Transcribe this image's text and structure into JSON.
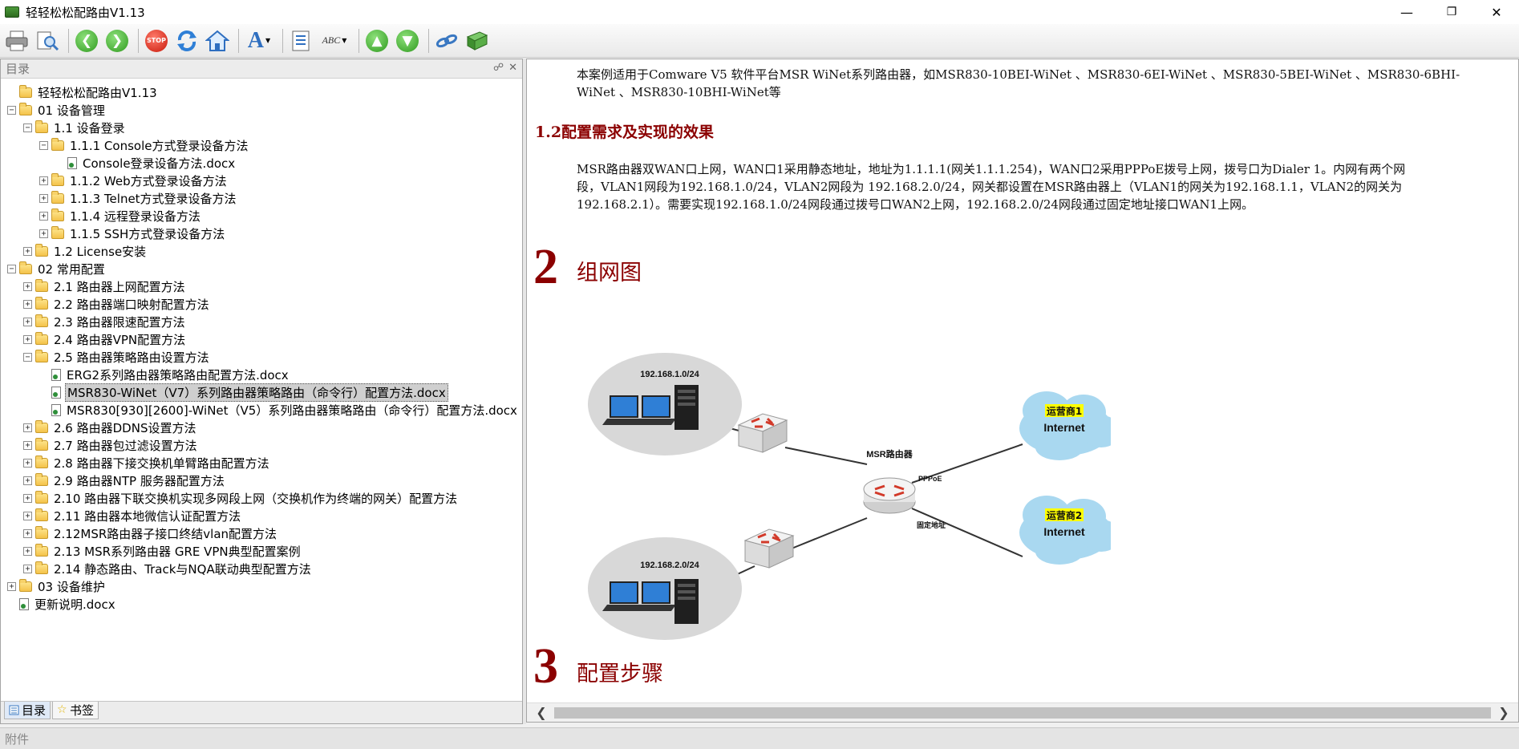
{
  "window": {
    "title": "轻轻松松配路由V1.13",
    "minimize": "—",
    "maximize": "❐",
    "close": "✕"
  },
  "toolbar": {
    "stop_label": "STOP",
    "font_label": "A",
    "spell_label": "ABC"
  },
  "left_panel": {
    "title": "目录",
    "tabs": [
      {
        "label": "目录",
        "active": true
      },
      {
        "label": "书签",
        "active": false
      }
    ]
  },
  "tree": [
    {
      "level": 0,
      "type": "folder",
      "expander": "none",
      "label": "轻轻松松配路由V1.13"
    },
    {
      "level": 0,
      "type": "folder",
      "expander": "minus",
      "label": "01 设备管理"
    },
    {
      "level": 1,
      "type": "folder",
      "expander": "minus",
      "label": "1.1 设备登录"
    },
    {
      "level": 2,
      "type": "folder",
      "expander": "minus",
      "label": "1.1.1 Console方式登录设备方法"
    },
    {
      "level": 3,
      "type": "doc",
      "expander": "none",
      "label": "Console登录设备方法.docx"
    },
    {
      "level": 2,
      "type": "folder",
      "expander": "plus",
      "label": "1.1.2 Web方式登录设备方法"
    },
    {
      "level": 2,
      "type": "folder",
      "expander": "plus",
      "label": "1.1.3 Telnet方式登录设备方法"
    },
    {
      "level": 2,
      "type": "folder",
      "expander": "plus",
      "label": "1.1.4 远程登录设备方法"
    },
    {
      "level": 2,
      "type": "folder",
      "expander": "plus",
      "label": "1.1.5 SSH方式登录设备方法"
    },
    {
      "level": 1,
      "type": "folder",
      "expander": "plus",
      "label": "1.2 License安装"
    },
    {
      "level": 0,
      "type": "folder",
      "expander": "minus",
      "label": "02 常用配置"
    },
    {
      "level": 1,
      "type": "folder",
      "expander": "plus",
      "label": "2.1 路由器上网配置方法"
    },
    {
      "level": 1,
      "type": "folder",
      "expander": "plus",
      "label": "2.2 路由器端口映射配置方法"
    },
    {
      "level": 1,
      "type": "folder",
      "expander": "plus",
      "label": "2.3 路由器限速配置方法"
    },
    {
      "level": 1,
      "type": "folder",
      "expander": "plus",
      "label": "2.4 路由器VPN配置方法"
    },
    {
      "level": 1,
      "type": "folder",
      "expander": "minus",
      "label": "2.5 路由器策略路由设置方法"
    },
    {
      "level": 2,
      "type": "doc",
      "expander": "none",
      "label": "ERG2系列路由器策略路由配置方法.docx"
    },
    {
      "level": 2,
      "type": "doc",
      "expander": "none",
      "label": "MSR830-WiNet（V7）系列路由器策略路由（命令行）配置方法.docx",
      "selected": true
    },
    {
      "level": 2,
      "type": "doc",
      "expander": "none",
      "label": "MSR830[930][2600]-WiNet（V5）系列路由器策略路由（命令行）配置方法.docx"
    },
    {
      "level": 1,
      "type": "folder",
      "expander": "plus",
      "label": "2.6 路由器DDNS设置方法"
    },
    {
      "level": 1,
      "type": "folder",
      "expander": "plus",
      "label": "2.7 路由器包过滤设置方法"
    },
    {
      "level": 1,
      "type": "folder",
      "expander": "plus",
      "label": "2.8 路由器下接交换机单臂路由配置方法"
    },
    {
      "level": 1,
      "type": "folder",
      "expander": "plus",
      "label": "2.9 路由器NTP 服务器配置方法"
    },
    {
      "level": 1,
      "type": "folder",
      "expander": "plus",
      "label": "2.10 路由器下联交换机实现多网段上网（交换机作为终端的网关）配置方法"
    },
    {
      "level": 1,
      "type": "folder",
      "expander": "plus",
      "label": "2.11 路由器本地微信认证配置方法"
    },
    {
      "level": 1,
      "type": "folder",
      "expander": "plus",
      "label": "2.12MSR路由器子接口终结vlan配置方法"
    },
    {
      "level": 1,
      "type": "folder",
      "expander": "plus",
      "label": "2.13 MSR系列路由器 GRE VPN典型配置案例"
    },
    {
      "level": 1,
      "type": "folder",
      "expander": "plus",
      "label": "2.14 静态路由、Track与NQA联动典型配置方法"
    },
    {
      "level": 0,
      "type": "folder",
      "expander": "plus",
      "label": "03 设备维护"
    },
    {
      "level": 0,
      "type": "doc",
      "expander": "none",
      "label": "更新说明.docx"
    }
  ],
  "document": {
    "intro_line1": "本案例适用于Comware V5 软件平台MSR WiNet系列路由器，如MSR830-10BEI-WiNet 、MSR830-6EI-WiNet 、MSR830-5BEI-WiNet 、MSR830-6BHI-",
    "intro_line2": "WiNet 、MSR830-10BHI-WiNet等",
    "section_1_2": "1.2配置需求及实现的效果",
    "req_line1": "MSR路由器双WAN口上网，WAN口1采用静态地址，地址为1.1.1.1(网关1.1.1.254)，WAN口2采用PPPoE拨号上网，拨号口为Dialer 1。内网有两个网",
    "req_line2": "段，VLAN1网段为192.168.1.0/24，VLAN2网段为 192.168.2.0/24，网关都设置在MSR路由器上（VLAN1的网关为192.168.1.1，VLAN2的网关为",
    "req_line3": "192.168.2.1）。需要实现192.168.1.0/24网段通过拨号口WAN2上网，192.168.2.0/24网段通过固定地址接口WAN1上网。",
    "section_2_num": "2",
    "section_2_title": "组网图",
    "section_3_num": "3",
    "section_3_title": "配置步骤",
    "diagram": {
      "lan1": "192.168.1.0/24",
      "lan2": "192.168.2.0/24",
      "router_label": "MSR路由器",
      "pppoe_label": "PPPoE",
      "fixed_label": "固定地址",
      "isp1": "运营商1",
      "isp2": "运营商2",
      "internet1": "Internet",
      "internet2": "Internet"
    }
  },
  "statusbar": {
    "text": "附件"
  }
}
